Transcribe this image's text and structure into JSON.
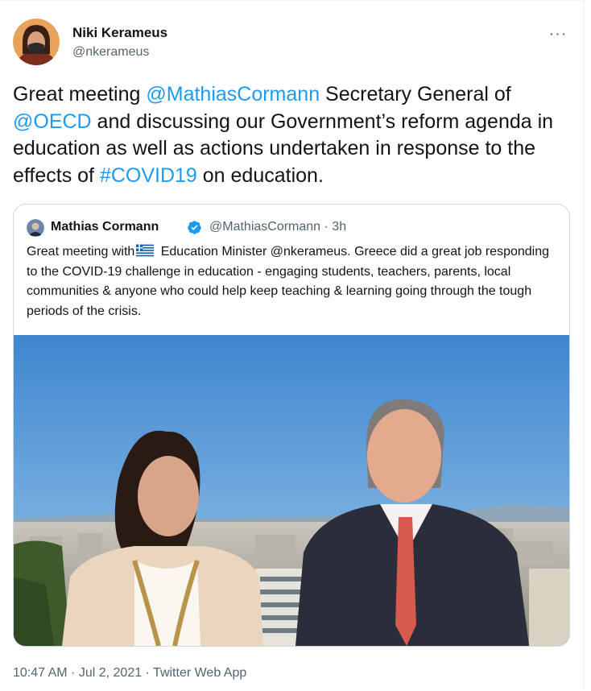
{
  "tweet": {
    "author": {
      "name": "Niki Kerameus",
      "handle": "@nkerameus"
    },
    "more_label": "···",
    "text": {
      "p1": "Great meeting ",
      "m1": "@MathiasCormann",
      "p2": " Secretary General of ",
      "m2": "@OECD",
      "p3": " and discussing our Government’s reform agenda in education as well as actions undertaken in response to the effects of ",
      "m3": "#COVID19",
      "p4": " on education."
    },
    "quote": {
      "author": {
        "name": "Mathias Cormann",
        "verified": true,
        "handle_time": "@MathiasCormann · 3h"
      },
      "text_a": "Great meeting with",
      "flag": "greece-flag-icon",
      "text_b": " Education Minister @nkerameus. Greece did a great job responding to the COVID-19 challenge in education - engaging students, teachers, parents, local communities & anyone who could help keep teaching & learning going through the tough periods of the crisis."
    },
    "footer": {
      "time": "10:47 AM",
      "sep1": " · ",
      "date": "Jul 2, 2021",
      "sep2": " · ",
      "source": "Twitter Web App"
    }
  },
  "colors": {
    "accent": "#1d9bf0",
    "text": "#0f1419",
    "secondary": "#536471",
    "border": "#cfd9de"
  }
}
